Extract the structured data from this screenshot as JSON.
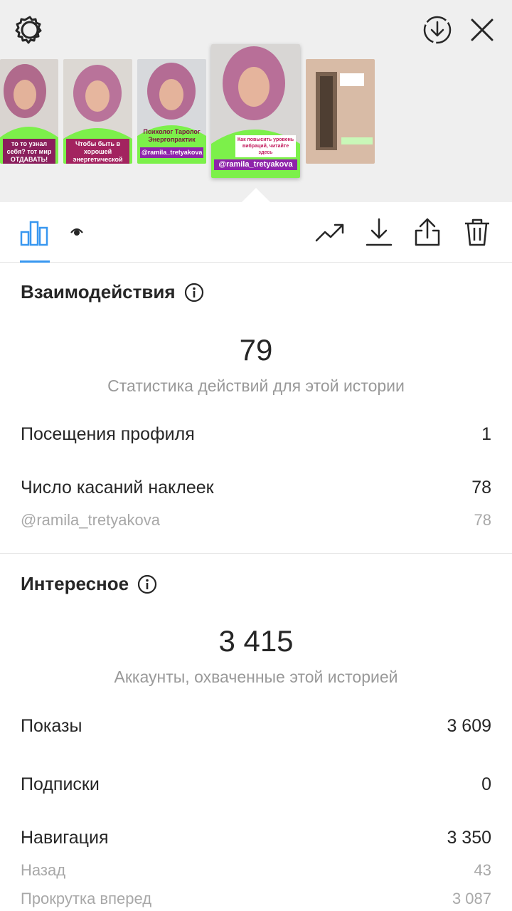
{
  "header": {
    "settings_icon": "gear-icon",
    "download_icon": "download-circle-icon",
    "close_icon": "close-icon"
  },
  "stories": [
    {
      "caption": "то то узнал себя? тот мир ОТДАВАТЬ!"
    },
    {
      "caption": "Чтобы быть в хорошей энергетической форме, нужно научиться больше отдавать, чем брать!"
    },
    {
      "caption": "Психолог Таролог Энергопрактик",
      "handle": "@ramila_tretyakova"
    },
    {
      "caption": "Как повысить уровень вибраций, читайте здесь",
      "handle": "@ramila_tretyakova"
    },
    {
      "caption": ""
    }
  ],
  "toolbar": {
    "tabs": [
      "bar-chart-icon",
      "eye-icon"
    ],
    "actions": [
      "trending-icon",
      "download-icon",
      "share-icon",
      "trash-icon"
    ],
    "accent": "#3897f0"
  },
  "interactions": {
    "title": "Взаимодействия",
    "total": "79",
    "caption": "Статистика действий для этой истории",
    "rows": [
      {
        "label": "Посещения профиля",
        "value": "1"
      },
      {
        "label": "Число касаний наклеек",
        "value": "78"
      }
    ],
    "sub_rows": [
      {
        "label": "@ramila_tretyakova",
        "value": "78"
      }
    ]
  },
  "discovery": {
    "title": "Интересное",
    "total": "3 415",
    "caption": "Аккаунты, охваченные этой историей",
    "rows": [
      {
        "label": "Показы",
        "value": "3 609"
      },
      {
        "label": "Подписки",
        "value": "0"
      },
      {
        "label": "Навигация",
        "value": "3 350"
      }
    ],
    "sub_rows": [
      {
        "label": "Назад",
        "value": "43"
      },
      {
        "label": "Прокрутка вперед",
        "value": "3 087"
      }
    ]
  }
}
